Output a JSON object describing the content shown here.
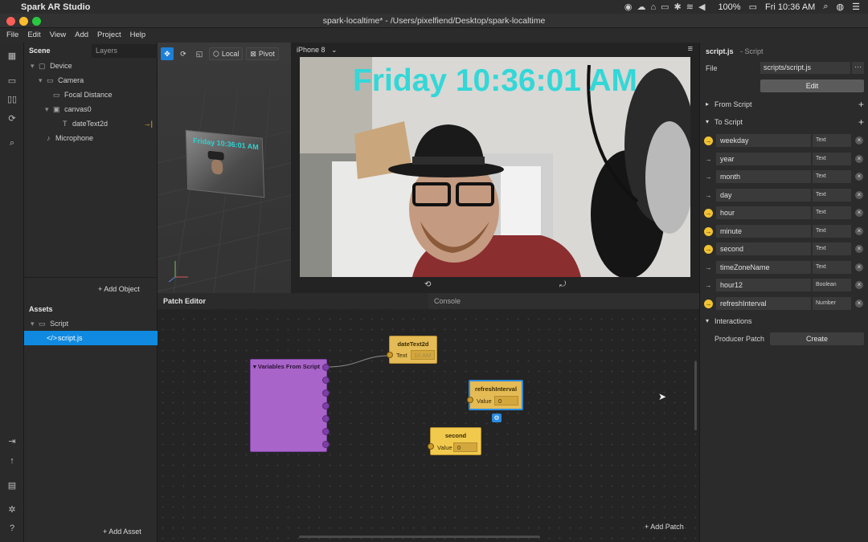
{
  "mac": {
    "app_name": "Spark AR Studio",
    "battery": "100%",
    "clock": "Fri 10:36 AM"
  },
  "window": {
    "title": "spark-localtime* - /Users/pixelfiend/Desktop/spark-localtime"
  },
  "menu": [
    "File",
    "Edit",
    "View",
    "Add",
    "Project",
    "Help"
  ],
  "scene": {
    "tab_scene": "Scene",
    "tab_layers": "Layers",
    "tree": [
      "Device",
      "Camera",
      "Focal Distance",
      "canvas0",
      "dateText2d",
      "Microphone"
    ],
    "add_object": "+ Add Object"
  },
  "assets": {
    "title": "Assets",
    "folder": "Script",
    "file": "script.js",
    "add_asset": "+ Add Asset"
  },
  "viewport": {
    "local": "Local",
    "pivot": "Pivot",
    "mini_text": "Friday 10:36:01 AM"
  },
  "preview": {
    "device": "iPhone 8",
    "overlay_text": "Friday 10:36:01 AM"
  },
  "patch": {
    "tab_patch": "Patch Editor",
    "tab_console": "Console",
    "add_patch": "+ Add Patch",
    "vars_node": "Variables From Script",
    "date_node": {
      "title": "dateText2d",
      "port": "Text",
      "value": "10 AM"
    },
    "refresh_node": {
      "title": "refreshInterval",
      "port": "Value",
      "value": "0"
    },
    "second_node": {
      "title": "second",
      "port": "Value",
      "value": "0"
    }
  },
  "inspector": {
    "title": "script.js",
    "subtitle": "- Script",
    "file_label": "File",
    "file_value": "scripts/script.js",
    "edit": "Edit",
    "from_script": "From Script",
    "to_script": "To Script",
    "vars": [
      {
        "name": "weekday",
        "type": "Text",
        "icon": "y"
      },
      {
        "name": "year",
        "type": "Text",
        "icon": "a"
      },
      {
        "name": "month",
        "type": "Text",
        "icon": "a"
      },
      {
        "name": "day",
        "type": "Text",
        "icon": "a"
      },
      {
        "name": "hour",
        "type": "Text",
        "icon": "y"
      },
      {
        "name": "minute",
        "type": "Text",
        "icon": "y"
      },
      {
        "name": "second",
        "type": "Text",
        "icon": "y"
      },
      {
        "name": "timeZoneName",
        "type": "Text",
        "icon": "a"
      },
      {
        "name": "hour12",
        "type": "Boolean",
        "icon": "a"
      },
      {
        "name": "refreshInterval",
        "type": "Number",
        "icon": "y"
      }
    ],
    "interactions": "Interactions",
    "producer_patch": "Producer Patch",
    "create": "Create"
  }
}
